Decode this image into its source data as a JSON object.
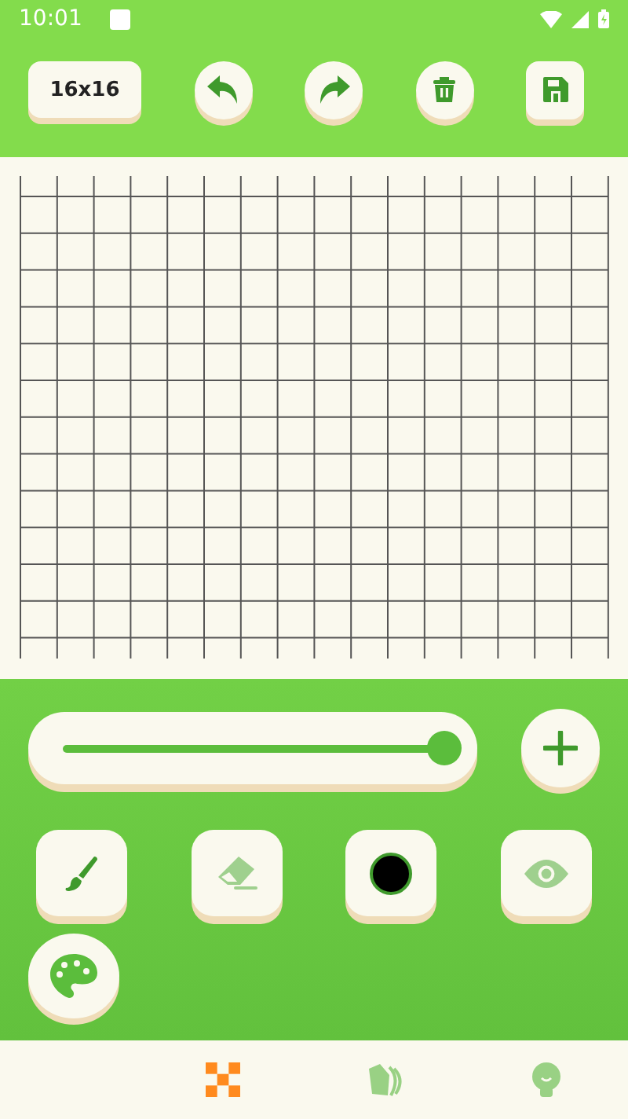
{
  "status_bar": {
    "time": "10:01"
  },
  "toolbar": {
    "size_label": "16x16",
    "actions": [
      {
        "kind": "undo"
      },
      {
        "kind": "redo"
      },
      {
        "kind": "delete"
      },
      {
        "kind": "save"
      }
    ]
  },
  "brush_size": {
    "level": 0.97
  },
  "tools": [
    {
      "kind": "brush",
      "selected": true
    },
    {
      "kind": "eraser",
      "selected": false
    },
    {
      "kind": "color",
      "color": "#000000"
    },
    {
      "kind": "preview",
      "selected": false
    }
  ],
  "nav": [
    {
      "kind": "grid",
      "selected": true
    },
    {
      "kind": "gallery",
      "selected": false
    },
    {
      "kind": "profile",
      "selected": false
    }
  ]
}
